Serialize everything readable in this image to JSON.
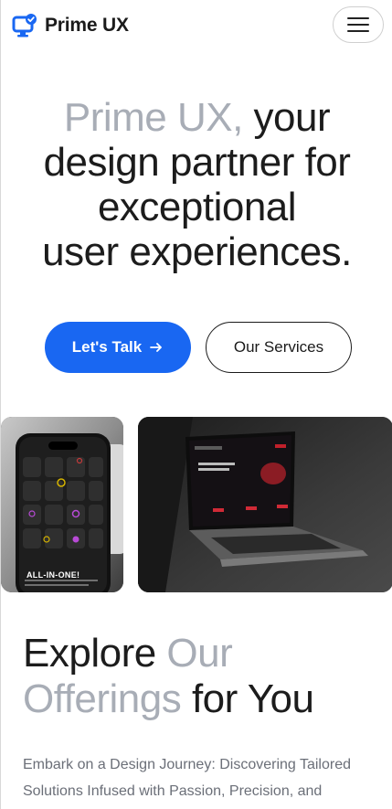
{
  "header": {
    "brand": "Prime UX",
    "logo_icon": "monitor-check-icon",
    "menu_icon": "hamburger-menu-icon"
  },
  "hero": {
    "highlight": "Prime UX,",
    "line1_rest": " your",
    "line2": "design partner for",
    "line3": "exceptional",
    "line4": "user experiences."
  },
  "cta": {
    "primary_label": "Let's Talk",
    "primary_icon": "arrow-right-icon",
    "secondary_label": "Our Services"
  },
  "showcase": {
    "phone_caption": "ALL-IN-ONE!",
    "laptop_card": "laptop-mockup-image"
  },
  "offerings": {
    "title_w1": "Explore",
    "title_w2": "Our",
    "title_w3": "Offerings",
    "title_w4": "for You",
    "lead": "Embark on a Design Journey: Discovering Tailored Solutions Infused with Passion, Precision, and"
  },
  "colors": {
    "accent": "#1967f2",
    "muted_text": "#a8adb6",
    "body_text": "#1c1c1c"
  }
}
